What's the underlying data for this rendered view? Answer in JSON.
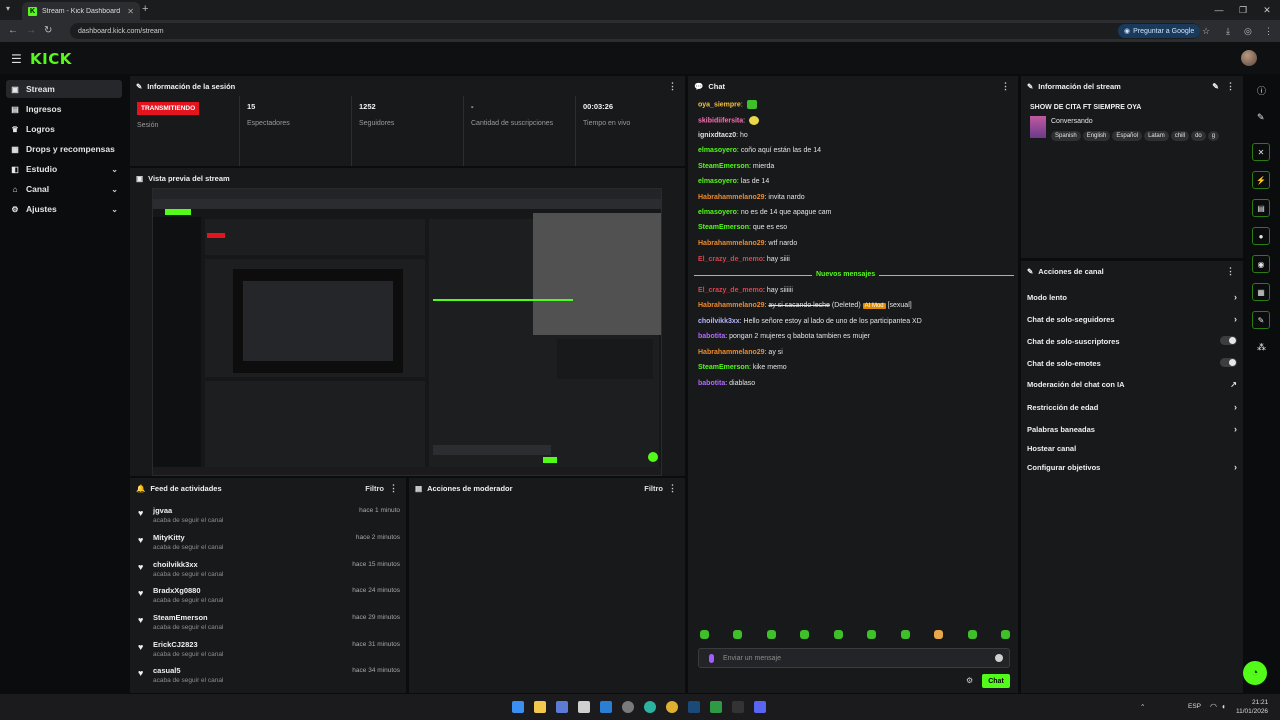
{
  "browser": {
    "tab_title": "Stream - Kick Dashboard",
    "url": "dashboard.kick.com/stream",
    "ask_google": "Preguntar a Google"
  },
  "app": {
    "logo": "KICK"
  },
  "sidebar": {
    "items": [
      {
        "label": "Stream",
        "icon": "broadcast-icon",
        "active": true
      },
      {
        "label": "Ingresos",
        "icon": "wallet-icon"
      },
      {
        "label": "Logros",
        "icon": "trophy-icon"
      },
      {
        "label": "Drops y recompensas",
        "icon": "gift-icon"
      },
      {
        "label": "Estudio",
        "icon": "studio-icon"
      },
      {
        "label": "Canal",
        "icon": "channel-icon"
      },
      {
        "label": "Ajustes",
        "icon": "gear-icon"
      }
    ]
  },
  "session": {
    "title": "Información de la sesión",
    "status_badge": "TRANSMITIENDO",
    "status_label": "Sesión",
    "viewers_value": "15",
    "viewers_label": "Espectadores",
    "followers_value": "1252",
    "followers_label": "Seguidores",
    "subs_value": "-",
    "subs_label": "Cantidad de suscripciones",
    "live_value": "00:03:26",
    "live_label": "Tiempo en vivo"
  },
  "preview": {
    "title": "Vista previa del stream"
  },
  "activity": {
    "title": "Feed de actividades",
    "filter": "Filtro",
    "items": [
      {
        "name": "jgvaa",
        "sub": "acaba de seguir el canal",
        "time": "hace 1 minuto"
      },
      {
        "name": "MityKitty",
        "sub": "acaba de seguir el canal",
        "time": "hace 2 minutos"
      },
      {
        "name": "choilvikk3xx",
        "sub": "acaba de seguir el canal",
        "time": "hace 15 minutos"
      },
      {
        "name": "BradxXg0880",
        "sub": "acaba de seguir el canal",
        "time": "hace 24 minutos"
      },
      {
        "name": "SteamEmerson",
        "sub": "acaba de seguir el canal",
        "time": "hace 29 minutos"
      },
      {
        "name": "ErickCJ2823",
        "sub": "acaba de seguir el canal",
        "time": "hace 31 minutos"
      },
      {
        "name": "casual5",
        "sub": "acaba de seguir el canal",
        "time": "hace 34 minutos"
      }
    ]
  },
  "mod_actions": {
    "title": "Acciones de moderador",
    "filter": "Filtro"
  },
  "chat": {
    "title": "Chat",
    "new_messages": "Nuevos mensajes",
    "messages": [
      {
        "user": "oya_siempre",
        "color": "#f5c242",
        "text": ""
      },
      {
        "user": "skibidiifersita",
        "color": "#ff6fb5",
        "text": ""
      },
      {
        "user": "ignixdtacz0",
        "color": "#e0e0e0",
        "text": "ho"
      },
      {
        "user": "elmasoyero",
        "color": "#53fc18",
        "text": "coño aquí están las de 14"
      },
      {
        "user": "SteamEmerson",
        "color": "#53fc18",
        "text": "mierda"
      },
      {
        "user": "elmasoyero",
        "color": "#53fc18",
        "text": "las de 14"
      },
      {
        "user": "Habrahammelano29",
        "color": "#f08a2c",
        "text": "invita nardo"
      },
      {
        "user": "elmasoyero",
        "color": "#53fc18",
        "text": "no es de 14 que apague cam"
      },
      {
        "user": "SteamEmerson",
        "color": "#53fc18",
        "text": "que es eso"
      },
      {
        "user": "Habrahammelano29",
        "color": "#f08a2c",
        "text": "wtf nardo"
      },
      {
        "user": "El_crazy_de_memo",
        "color": "#e0424a",
        "text": "hay siiii"
      }
    ],
    "after": [
      {
        "user": "El_crazy_de_memo",
        "color": "#e0424a",
        "text": "hay siiiiii"
      },
      {
        "user": "Habrahammelano29",
        "color": "#f08a2c",
        "text": "ay si sacando leche",
        "deleted": "(Deleted)",
        "ai": "AI Mod",
        "flag": "[sexual]"
      },
      {
        "user": "choilvikk3xx",
        "color": "#b5b5ff",
        "text": "Hello señore estoy al lado de uno de los participantea XD"
      },
      {
        "user": "babotita",
        "color": "#b26bff",
        "text": "pongan 2 mujeres q babota tambien es mujer"
      },
      {
        "user": "Habrahammelano29",
        "color": "#f08a2c",
        "text": "ay si"
      },
      {
        "user": "SteamEmerson",
        "color": "#53fc18",
        "text": "kike memo"
      },
      {
        "user": "babotita",
        "color": "#b26bff",
        "text": "diablaso"
      }
    ],
    "input_placeholder": "Enviar un mensaje",
    "send_label": "Chat"
  },
  "stream_info": {
    "title": "Información del stream",
    "stream_title": "SHOW DE CITA FT SIEMPRE OYA",
    "category": "Conversando",
    "tags": [
      "Spanish",
      "English",
      "Español",
      "Latam",
      "chill",
      "do",
      "g"
    ]
  },
  "channel_actions": {
    "title": "Acciones de canal",
    "items": [
      {
        "label": "Modo lento",
        "kind": "chevron"
      },
      {
        "label": "Chat de solo-seguidores",
        "kind": "chevron"
      },
      {
        "label": "Chat de solo-suscriptores",
        "kind": "toggle"
      },
      {
        "label": "Chat de solo-emotes",
        "kind": "toggle"
      },
      {
        "label": "Moderación del chat con IA",
        "kind": "external"
      },
      {
        "label": "Restricción de edad",
        "kind": "chevron"
      },
      {
        "label": "Palabras baneadas",
        "kind": "chevron"
      },
      {
        "label": "Hostear canal",
        "kind": "none"
      },
      {
        "label": "Configurar objetivos",
        "kind": "chevron"
      }
    ]
  },
  "taskbar": {
    "lang": "ESP",
    "time": "21:21",
    "date": "11/01/2026"
  },
  "colors": {
    "accent": "#53fc18",
    "live": "#e4141e",
    "panel": "#18191b",
    "bg": "#0b0c0d"
  }
}
